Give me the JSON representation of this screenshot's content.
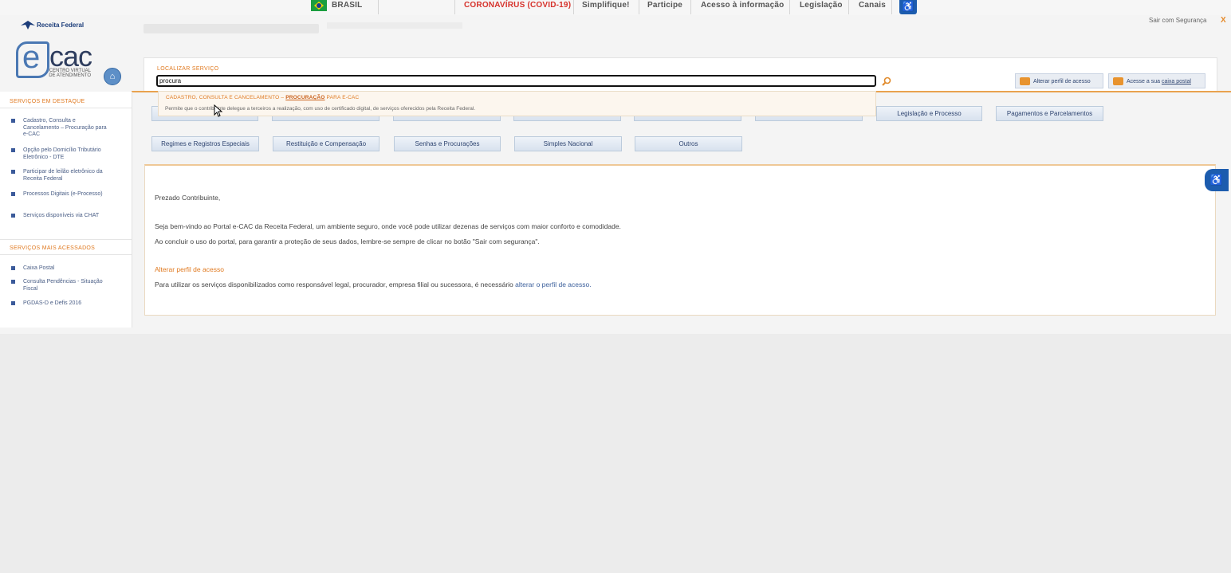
{
  "govbar": {
    "country": "BRASIL",
    "links": [
      "CORONAVÍRUS (COVID-19)",
      "Simplifique!",
      "Participe",
      "Acesso à informação",
      "Legislação",
      "Canais"
    ],
    "accessibility_icon": "accessibility-icon"
  },
  "header": {
    "logout_label": "Sair com Segurança",
    "logout_close": "X",
    "org_name": "Receita Federal",
    "logo_e": "e",
    "logo_cac": "cac",
    "logo_subtitle": "CENTRO VIRTUAL DE ATENDIMENTO"
  },
  "search": {
    "label": "LOCALIZAR SERVIÇO",
    "value": "procura",
    "suggestion_prefix": "CADASTRO, CONSULTA E CANCELAMENTO – ",
    "suggestion_highlight": "PROCURAÇÃO",
    "suggestion_suffix": " PARA E-CAC",
    "suggestion_description": "Permite que o contribuinte delegue a terceiros a realização, com uso de certificado digital, de serviços oferecidos pela Receita Federal."
  },
  "top_buttons": {
    "change_profile": "Alterar perfil de acesso",
    "mailbox_prefix": "Acesse a sua ",
    "mailbox_link": "caixa postal"
  },
  "sidebar": {
    "highlight_title": "SERVIÇOS EM DESTAQUE",
    "highlight_items": [
      "Cadastro, Consulta e Cancelamento – Procuração para e-CAC",
      "Opção pelo Domicílio Tributário Eletrônico - DTE",
      "Participar de leilão eletrônico da Receita Federal",
      "Processos Digitais (e-Processo)",
      "Serviços disponíveis via CHAT"
    ],
    "most_accessed_title": "SERVIÇOS MAIS ACESSADOS",
    "most_accessed_items": [
      "Caixa Postal",
      "Consulta Pendências - Situação Fiscal",
      "PGDAS-D e Defis 2016"
    ]
  },
  "tabs": {
    "row1": [
      "Legislação e Processo",
      "Pagamentos e Parcelamentos"
    ],
    "row2": [
      "Regimes e Registros Especiais",
      "Restituição e Compensação",
      "Senhas e Procurações",
      "Simples Nacional",
      "Outros"
    ]
  },
  "content": {
    "greeting": "Prezado Contribuinte,",
    "para1": "Seja bem-vindo ao Portal e-CAC da Receita Federal, um ambiente seguro, onde você pode utilizar dezenas de serviços com maior conforto e comodidade.",
    "para2": "Ao concluir o uso do portal, para garantir a proteção de seus dados, lembre-se sempre de clicar no botão \"Sair com segurança\".",
    "profile_heading": "Alterar perfil de acesso",
    "para3_prefix": "Para utilizar os serviços disponibilizados como responsável legal, procurador, empresa filial ou sucessora, é necessário ",
    "para3_link": "alterar o perfil de acesso."
  },
  "colors": {
    "accent_orange": "#e07a21",
    "link_blue": "#3b5f9b",
    "gov_red": "#d6322b",
    "access_blue": "#1c5cae"
  }
}
